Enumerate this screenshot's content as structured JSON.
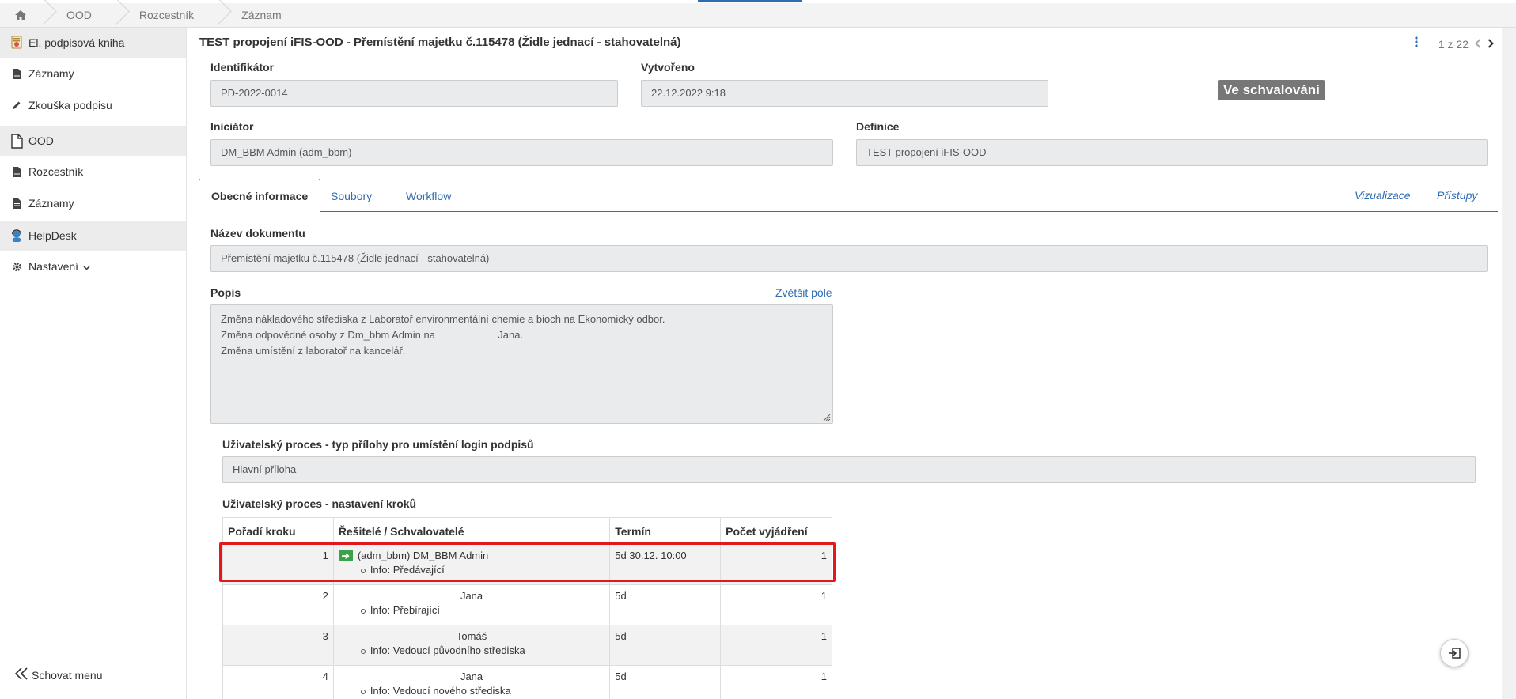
{
  "breadcrumb": {
    "items": [
      "OOD",
      "Rozcestník",
      "Záznam"
    ]
  },
  "sidebar": {
    "sections": [
      {
        "label": "El. podpisová kniha",
        "icon": "certificate-icon"
      },
      {
        "label": "OOD",
        "icon": "file-icon"
      },
      {
        "label": "HelpDesk",
        "icon": "support-agent-icon"
      }
    ],
    "items": {
      "zaznamy1": "Záznamy",
      "zkouska": "Zkouška podpisu",
      "rozcestnik": "Rozcestník",
      "zaznamy2": "Záznamy",
      "nastaveni": "Nastavení"
    },
    "hide_menu": "Schovat menu"
  },
  "header": {
    "title": "TEST propojení iFIS-OOD - Přemístění majetku č.115478 (Židle jednací - stahovatelná)",
    "pager": "1 z 22"
  },
  "record": {
    "identifikator_label": "Identifikátor",
    "identifikator": "PD-2022-0014",
    "vytvoreno_label": "Vytvořeno",
    "vytvoreno": "22.12.2022 9:18",
    "status": "Ve schvalování",
    "iniciator_label": "Iniciátor",
    "iniciator": "DM_BBM Admin (adm_bbm)",
    "definice_label": "Definice",
    "definice": "TEST propojení iFIS-OOD"
  },
  "tabs": {
    "general": "Obecné informace",
    "files": "Soubory",
    "workflow": "Workflow",
    "visualization": "Vizualizace",
    "access": "Přístupy"
  },
  "form": {
    "nazev_label": "Název dokumentu",
    "nazev": "Přemístění majetku č.115478 (Židle jednací - stahovatelná)",
    "popis_label": "Popis",
    "enlarge": "Zvětšit pole",
    "popis_line1": "Změna nákladového střediska z Laboratoř environmentální chemie a bioch na Ekonomický odbor.",
    "popis_line2a": "Změna odpovědné osoby z Dm_bbm Admin na",
    "popis_line2b": "Jana.",
    "popis_line3": "Změna umístění z laboratoř na kancelář.",
    "proces_typ_label": "Uživatelský proces - typ přílohy pro umístění login podpisů",
    "proces_typ": "Hlavní příloha",
    "proces_kroky_label": "Uživatelský proces - nastavení kroků"
  },
  "steps_table": {
    "headers": [
      "Pořadí kroku",
      "Řešitelé / Schvalovatelé",
      "Termín",
      "Počet vyjádření"
    ],
    "rows": [
      {
        "order": "1",
        "resolver": "(adm_bbm) DM_BBM Admin",
        "info": "Info: Předávající",
        "term": "5d 30.12. 10:00",
        "count": "1"
      },
      {
        "order": "2",
        "resolver": "Jana",
        "info": "Info: Přebírající",
        "term": "5d",
        "count": "1"
      },
      {
        "order": "3",
        "resolver": "Tomáš",
        "info": "Info: Vedoucí původního střediska",
        "term": "5d",
        "count": "1"
      },
      {
        "order": "4",
        "resolver": "Jana",
        "info": "Info: Vedoucí nového střediska",
        "term": "5d",
        "count": "1"
      }
    ]
  },
  "colors": {
    "accent": "#2f6cb3",
    "status_badge": "#777777",
    "highlight": "#e0191f",
    "active_step": "#3aa34a"
  }
}
